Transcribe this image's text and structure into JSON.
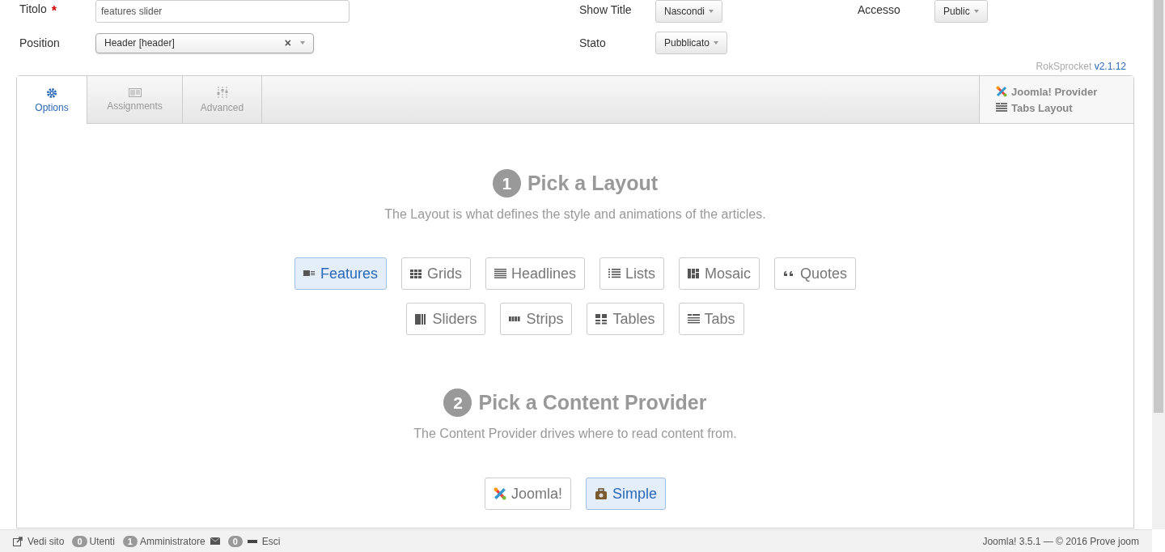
{
  "form": {
    "title": {
      "label": "Titolo",
      "required_mark": "*",
      "value": "features slider"
    },
    "position": {
      "label": "Position",
      "value": "Header [header]",
      "clear": "×"
    },
    "show_title": {
      "label": "Show Title",
      "value": "Nascondi"
    },
    "stato": {
      "label": "Stato",
      "value": "Pubblicato"
    },
    "accesso": {
      "label": "Accesso",
      "value": "Public"
    }
  },
  "version": {
    "name": "RokSprocket",
    "number": "v2.1.12"
  },
  "tabs": [
    {
      "label": "Options",
      "selected": true
    },
    {
      "label": "Assignments",
      "selected": false
    },
    {
      "label": "Advanced",
      "selected": false
    }
  ],
  "summary": {
    "provider": "Joomla! Provider",
    "layout": "Tabs Layout"
  },
  "step1": {
    "number": "1",
    "title": "Pick a Layout",
    "description": "The Layout is what defines the style and animations of the articles.",
    "layouts": [
      {
        "label": "Features",
        "selected": true
      },
      {
        "label": "Grids",
        "selected": false
      },
      {
        "label": "Headlines",
        "selected": false
      },
      {
        "label": "Lists",
        "selected": false
      },
      {
        "label": "Mosaic",
        "selected": false
      },
      {
        "label": "Quotes",
        "selected": false
      },
      {
        "label": "Sliders",
        "selected": false
      },
      {
        "label": "Strips",
        "selected": false
      },
      {
        "label": "Tables",
        "selected": false
      },
      {
        "label": "Tabs",
        "selected": false
      }
    ]
  },
  "step2": {
    "number": "2",
    "title": "Pick a Content Provider",
    "description": "The Content Provider drives where to read content from.",
    "providers": [
      {
        "label": "Joomla!",
        "selected": false
      },
      {
        "label": "Simple",
        "selected": true
      }
    ]
  },
  "status_bar": {
    "view_site": "Vedi sito",
    "users_count": "0",
    "users": "Utenti",
    "admins_count": "1",
    "admins": "Amministratore",
    "messages_count": "0",
    "logout": "Esci",
    "footer": "Joomla! 3.5.1 — © 2016 Prove joom"
  }
}
